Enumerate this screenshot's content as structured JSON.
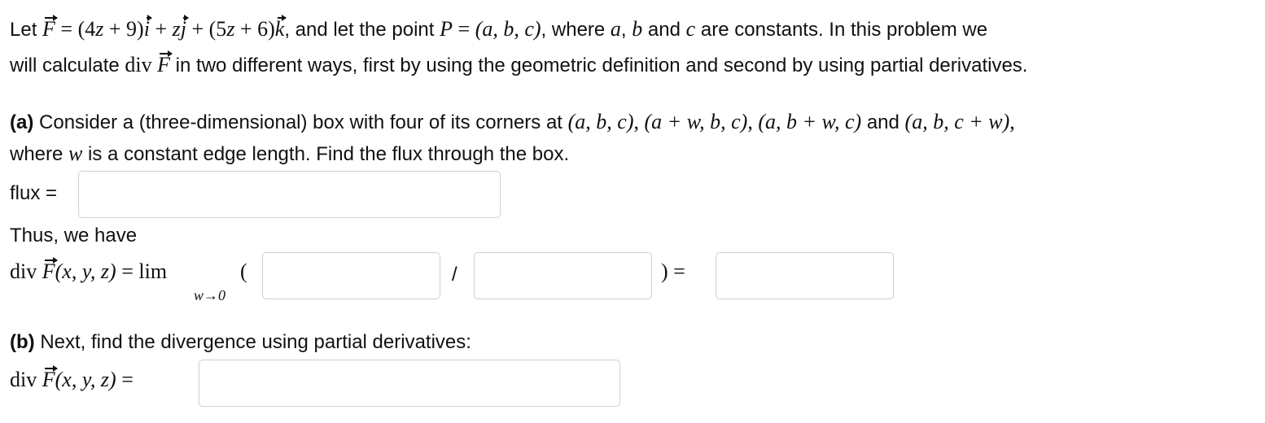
{
  "intro": {
    "line1_prefix": "Let ",
    "f_symbol": "F",
    "eq_sign": " = ",
    "field_expr_1": "(4",
    "field_var_z1": "z",
    "field_expr_2": " + 9)",
    "unit_i": "i",
    "field_plus_1": " + ",
    "field_var_z2": "z",
    "unit_j": "j",
    "field_plus_2": " + (5",
    "field_var_z3": "z",
    "field_expr_3": " + 6)",
    "unit_k": "k",
    "line1_mid": ", and let the point ",
    "point_name": "P",
    "point_eq": " = ",
    "point_coords": "(a, b, c)",
    "line1_where": ", where ",
    "const_a": "a",
    "const_sep": ", ",
    "const_b": "b",
    "line1_and": " and ",
    "const_c": "c",
    "line1_suffix": " are constants. In this problem we",
    "line2_prefix": "will calculate ",
    "div_label": "div ",
    "div_f": "F",
    "line2_suffix": " in two different ways, first by using the geometric definition and second by using partial derivatives."
  },
  "part_a": {
    "label": "(a)",
    "line1_text": " Consider a (three-dimensional) box with four of its corners at ",
    "corner_1": "(a, b, c)",
    "corner_sep_1": ", ",
    "corner_2": "(a + w, b, c)",
    "corner_sep_2": ", ",
    "corner_3": "(a, b + w, c)",
    "corner_and": " and ",
    "corner_4": "(a, b, c + w)",
    "line1_end": ",",
    "line2_prefix": "where ",
    "w_var": "w",
    "line2_suffix": " is a constant edge length. Find the flux through the box.",
    "flux_label": "flux =",
    "flux_value": "",
    "thus_text": "Thus, we have",
    "div_label": "div ",
    "div_f": "F",
    "div_args": "(x, y, z)",
    "lim_eq": " = ",
    "lim_word": "lim",
    "lim_sub": "w→0",
    "open_paren": "(",
    "numerator_value": "",
    "slash": "/",
    "denominator_value": "",
    "close_paren_eq": ") =",
    "result_value": ""
  },
  "part_b": {
    "label": "(b)",
    "text": " Next, find the divergence using partial derivatives:",
    "div_label": "div ",
    "div_f": "F",
    "div_args": "(x, y, z)",
    "eq_sign": " =",
    "answer_value": ""
  }
}
